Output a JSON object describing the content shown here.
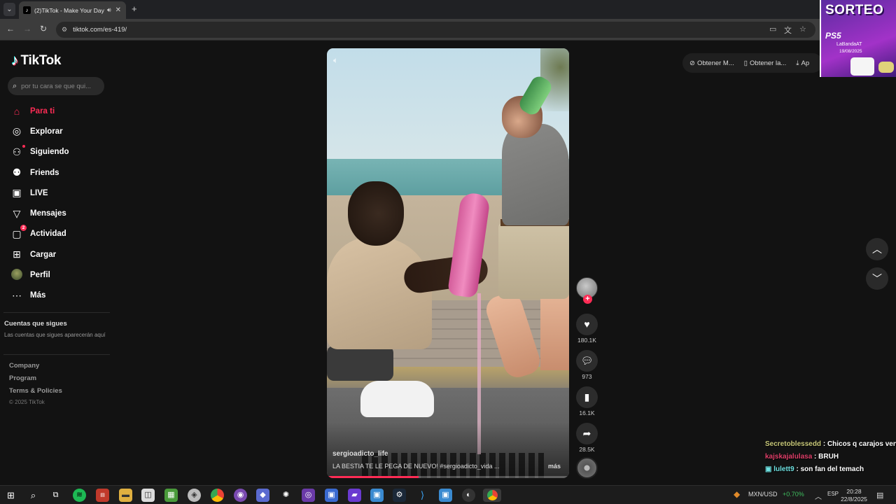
{
  "browser": {
    "tab_title": "(2)TikTok - Make Your Day",
    "url": "tiktok.com/es-419/"
  },
  "brand": {
    "name": "TikTok"
  },
  "search": {
    "placeholder": "por tu cara se que qui..."
  },
  "nav": [
    {
      "label": "Para ti",
      "icon": "home-icon",
      "active": true
    },
    {
      "label": "Explorar",
      "icon": "compass-icon"
    },
    {
      "label": "Siguiendo",
      "icon": "following-icon"
    },
    {
      "label": "Friends",
      "icon": "friends-icon"
    },
    {
      "label": "LIVE",
      "icon": "live-icon"
    },
    {
      "label": "Mensajes",
      "icon": "messages-icon"
    },
    {
      "label": "Actividad",
      "icon": "activity-icon",
      "badge": "2"
    },
    {
      "label": "Cargar",
      "icon": "upload-icon"
    },
    {
      "label": "Perfil",
      "icon": "profile-avatar"
    },
    {
      "label": "Más",
      "icon": "more-icon"
    }
  ],
  "following": {
    "title": "Cuentas que sigues",
    "subtitle": "Las cuentas que sigues aparecerán aquí"
  },
  "footer": {
    "links": [
      "Company",
      "Program",
      "Terms & Policies"
    ],
    "copyright": "© 2025 TikTok"
  },
  "video": {
    "author": "sergioadicto_life",
    "caption": "LA BESTIA TE LE PEGA DE NUEVO! #sergioadicto_vida ...",
    "more": "más",
    "progress": 0.38
  },
  "actions": {
    "likes": "180.1K",
    "comments": "973",
    "saves": "16.1K",
    "shares": "28.5K"
  },
  "top_buttons": {
    "item1": "Obtener M...",
    "item2": "Obtener la...",
    "item3": "Ap"
  },
  "overlay": {
    "title": "SORTEO",
    "product": "PS5",
    "line1": "LaBandaAT",
    "line2": "19/08/2025"
  },
  "chat": [
    {
      "user": "Secretoblessedd",
      "message": "Chicos q carajos ven"
    },
    {
      "user": "kajskajalulasa",
      "message": "BRUH"
    },
    {
      "user": "lulett9",
      "message": "son fan del temach"
    }
  ],
  "taskbar": {
    "currency": "MXN/USD",
    "change": "+0.70%",
    "lang": "ESP",
    "time": "20:28",
    "date": "22/8/2025"
  },
  "colors": {
    "accent": "#fe2c55",
    "background": "#121212",
    "positive": "#3fbf5f"
  }
}
